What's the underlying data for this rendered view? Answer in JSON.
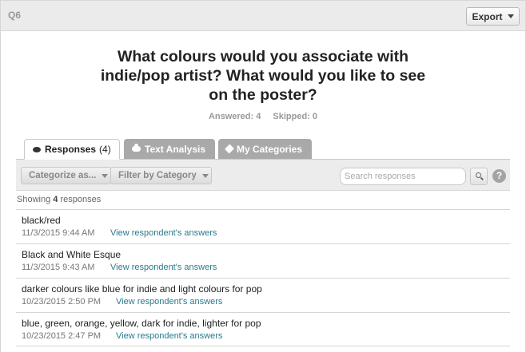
{
  "header": {
    "question_label": "Q6",
    "export_label": "Export"
  },
  "question": {
    "line1": "What colours would you associate with",
    "line2": "indie/pop artist? What would you like to see",
    "line3": "on the poster?"
  },
  "stats": {
    "answered": "Answered: 4",
    "skipped": "Skipped: 0"
  },
  "tabs": [
    {
      "label": "Responses",
      "count": "(4)",
      "icon": "speech-bubble-icon"
    },
    {
      "label": "Text Analysis",
      "icon": "cloud-icon"
    },
    {
      "label": "My Categories",
      "icon": "tag-icon"
    }
  ],
  "toolbar": {
    "categorize_label": "Categorize as...",
    "filter_label": "Filter by Category",
    "search_placeholder": "Search responses",
    "help_label": "?"
  },
  "showing": {
    "prefix": "Showing ",
    "count": "4",
    "suffix": " responses"
  },
  "responses": [
    {
      "text": "black/red",
      "date": "11/3/2015 9:44 AM",
      "link": "View respondent's answers"
    },
    {
      "text": "Black and White Esque",
      "date": "11/3/2015 9:43 AM",
      "link": "View respondent's answers"
    },
    {
      "text": "darker colours like blue for indie and light colours for pop",
      "date": "10/23/2015 2:50 PM",
      "link": "View respondent's answers"
    },
    {
      "text": "blue, green, orange, yellow, dark for indie, lighter for pop",
      "date": "10/23/2015 2:47 PM",
      "link": "View respondent's answers"
    }
  ],
  "colors": {
    "link": "#2a7a8c",
    "inactive_tab": "#a9a9a9",
    "toolbar_bg": "#ececec"
  }
}
